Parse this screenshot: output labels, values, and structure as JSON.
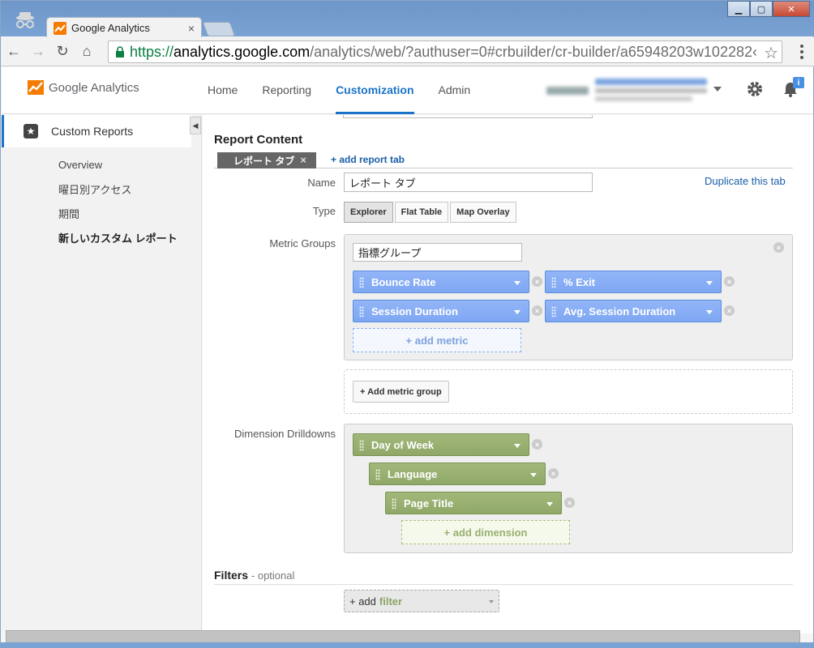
{
  "browser": {
    "tab_title": "Google Analytics",
    "tab_close": "×",
    "url_scheme": "https://",
    "url_host": "analytics.google.com",
    "url_path": "/analytics/web/?authuser=0#crbuilder/cr-builder/a65948203w102282‹",
    "star": "☆",
    "back": "←",
    "forward": "→",
    "reload": "↻",
    "home": "⌂",
    "minimize": "▁",
    "maximize": "▢",
    "close": "✕"
  },
  "header": {
    "logo_text": "Google Analytics",
    "nav": [
      {
        "label": "Home"
      },
      {
        "label": "Reporting"
      },
      {
        "label": "Customization"
      },
      {
        "label": "Admin"
      }
    ],
    "notification_badge": "i"
  },
  "sidebar": {
    "title": "Custom Reports",
    "toggle": "◀",
    "items": [
      {
        "label": "Overview"
      },
      {
        "label": "曜日別アクセス"
      },
      {
        "label": "期間"
      },
      {
        "label": "新しいカスタム レポート"
      }
    ]
  },
  "report": {
    "section_title": "Report Content",
    "active_tab": "レポート タブ",
    "active_tab_close": "×",
    "add_tab": "+ add report tab",
    "name_label": "Name",
    "name_value": "レポート タブ",
    "duplicate_tab": "Duplicate this tab",
    "type_label": "Type",
    "types": [
      "Explorer",
      "Flat Table",
      "Map Overlay"
    ],
    "metric_groups_label": "Metric Groups",
    "metric_group_name": "指標グループ",
    "metrics": [
      "Bounce Rate",
      "% Exit",
      "Session Duration",
      "Avg. Session Duration"
    ],
    "add_metric": "+ add metric",
    "add_metric_group": "+ Add metric group",
    "dimension_label": "Dimension Drilldowns",
    "dimensions": [
      "Day of Week",
      "Language",
      "Page Title"
    ],
    "add_dimension": "+ add dimension",
    "filters_title": "Filters",
    "filters_optional": "- optional",
    "add_filter_prefix": "+ add",
    "add_filter_word": "filter",
    "remove_glyph": "×"
  }
}
